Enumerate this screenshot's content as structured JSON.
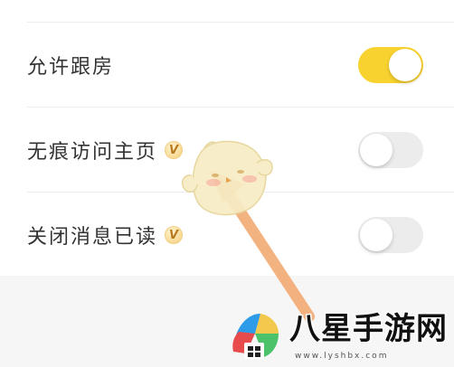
{
  "settings": {
    "rows": [
      {
        "label": "允许跟房",
        "vip": false,
        "enabled": true
      },
      {
        "label": "无痕访问主页",
        "vip": true,
        "enabled": false
      },
      {
        "label": "关闭消息已读",
        "vip": true,
        "enabled": false
      }
    ],
    "vip_badge": "V"
  },
  "watermark": {
    "brand": "八星手游网",
    "url": "www.lyshbx.com"
  },
  "colors": {
    "toggle_on": "#f8d22f",
    "toggle_off": "#ececec",
    "arrow": "#f2a66b"
  },
  "icons": [
    "duck-mascot-icon",
    "arrow-annotation",
    "brand-logo-icon"
  ]
}
